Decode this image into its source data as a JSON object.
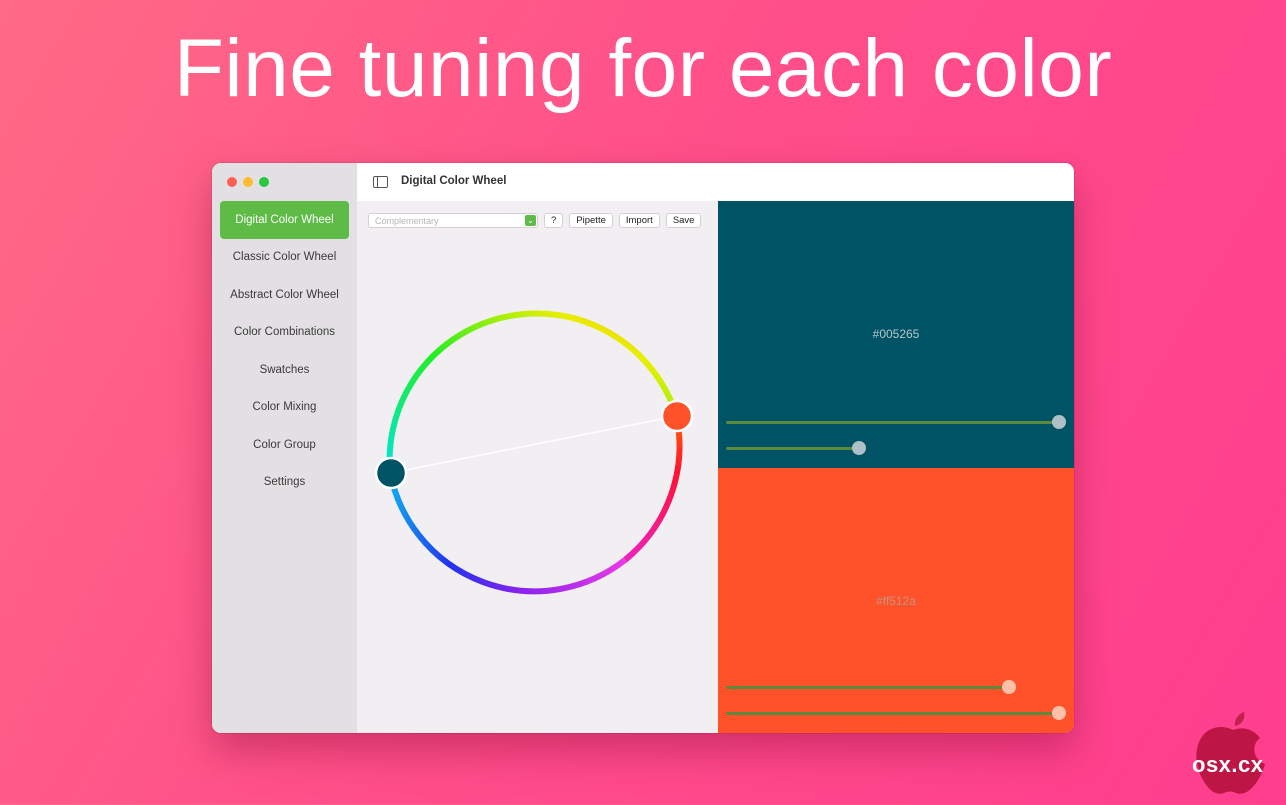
{
  "headline": "Fine tuning for each color",
  "window": {
    "title": "Digital Color Wheel"
  },
  "sidebar": {
    "items": [
      {
        "label": "Digital Color Wheel",
        "active": true
      },
      {
        "label": "Classic Color Wheel",
        "active": false
      },
      {
        "label": "Abstract Color Wheel",
        "active": false
      },
      {
        "label": "Color Combinations",
        "active": false
      },
      {
        "label": "Swatches",
        "active": false
      },
      {
        "label": "Color Mixing",
        "active": false
      },
      {
        "label": "Color Group",
        "active": false
      },
      {
        "label": "Settings",
        "active": false
      }
    ]
  },
  "toolbar": {
    "scheme_placeholder": "Complementary",
    "help_label": "?",
    "pipette_label": "Pipette",
    "import_label": "Import",
    "save_label": "Save"
  },
  "colors": {
    "accent": "#5dbb46",
    "primary": "#005265",
    "secondary": "#ff512a"
  },
  "swatches": [
    {
      "hex": "#005265",
      "color": "#005265",
      "slider1": 1.0,
      "slider2": 0.4
    },
    {
      "hex": "#ff512a",
      "color": "#ff512a",
      "slider1": 0.85,
      "slider2": 1.0
    }
  ],
  "wheel": {
    "marker1_color": "#005265",
    "marker2_color": "#ff512a"
  },
  "watermark": {
    "text": "osx.cx"
  }
}
